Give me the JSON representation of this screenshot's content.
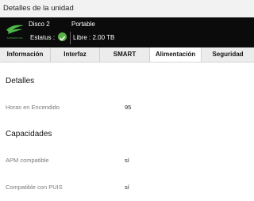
{
  "window": {
    "title": "Detalles de la unidad"
  },
  "header": {
    "brand": "SUPERCOOL",
    "disk_name": "Disco 2",
    "disk_type": "Portable",
    "status_label": "Estatus :",
    "free_space": "Libre : 2.00 TB",
    "status_color": "#59b347"
  },
  "tabs": [
    {
      "label": "Información"
    },
    {
      "label": "Interfaz"
    },
    {
      "label": "SMART"
    },
    {
      "label": "Alimentación",
      "active": true
    },
    {
      "label": "Seguridad"
    }
  ],
  "details": {
    "heading": "Detalles",
    "rows": [
      {
        "label": "Horas en Encendido",
        "value": "95"
      }
    ]
  },
  "capabilities": {
    "heading": "Capacidades",
    "rows": [
      {
        "label": "APM compatible",
        "value": "sí"
      },
      {
        "label": "Compatible con PUIS",
        "value": "sí"
      }
    ]
  }
}
